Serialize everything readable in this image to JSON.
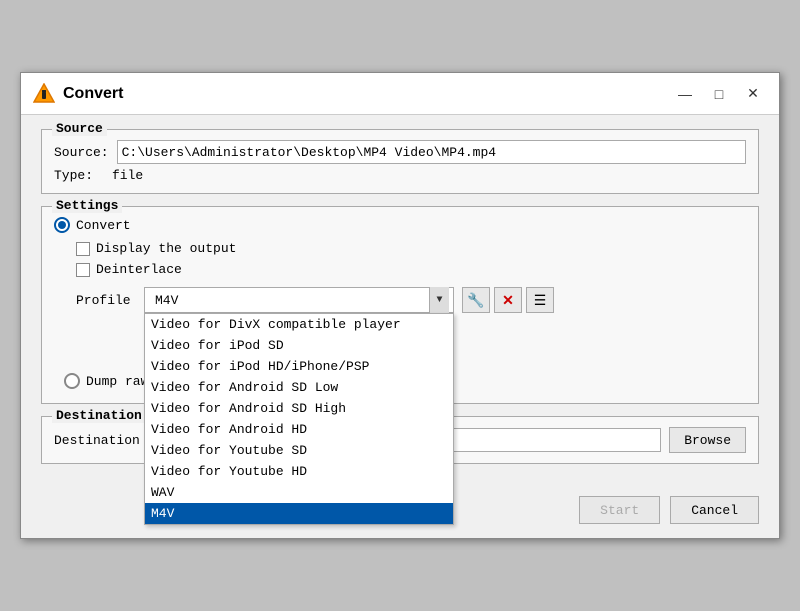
{
  "window": {
    "title": "Convert",
    "icon": "vlc",
    "buttons": {
      "minimize": "—",
      "maximize": "□",
      "close": "✕"
    }
  },
  "source": {
    "group_label": "Source",
    "source_label": "Source:",
    "source_value": "C:\\Users\\Administrator\\Desktop\\MP4 Video\\MP4.mp4",
    "type_label": "Type:",
    "type_value": "file"
  },
  "settings": {
    "group_label": "Settings",
    "convert_label": "Convert",
    "display_output_label": "Display the output",
    "deinterlace_label": "Deinterlace",
    "profile_label": "Profile",
    "profile_selected": "M4V",
    "profile_options": [
      "Video for DivX compatible player",
      "Video for iPod SD",
      "Video for iPod HD/iPhone/PSP",
      "Video for Android SD Low",
      "Video for Android SD High",
      "Video for Android HD",
      "Video for Youtube SD",
      "Video for Youtube HD",
      "WAV",
      "M4V"
    ],
    "dump_label": "Dump raw input",
    "wrench_icon": "🔧",
    "delete_icon": "✕",
    "list_icon": "☰"
  },
  "destination": {
    "group_label": "Destination",
    "dest_file_label": "Destination file:",
    "dest_value": "",
    "browse_label": "Browse"
  },
  "footer": {
    "start_label": "Start",
    "cancel_label": "Cancel"
  }
}
